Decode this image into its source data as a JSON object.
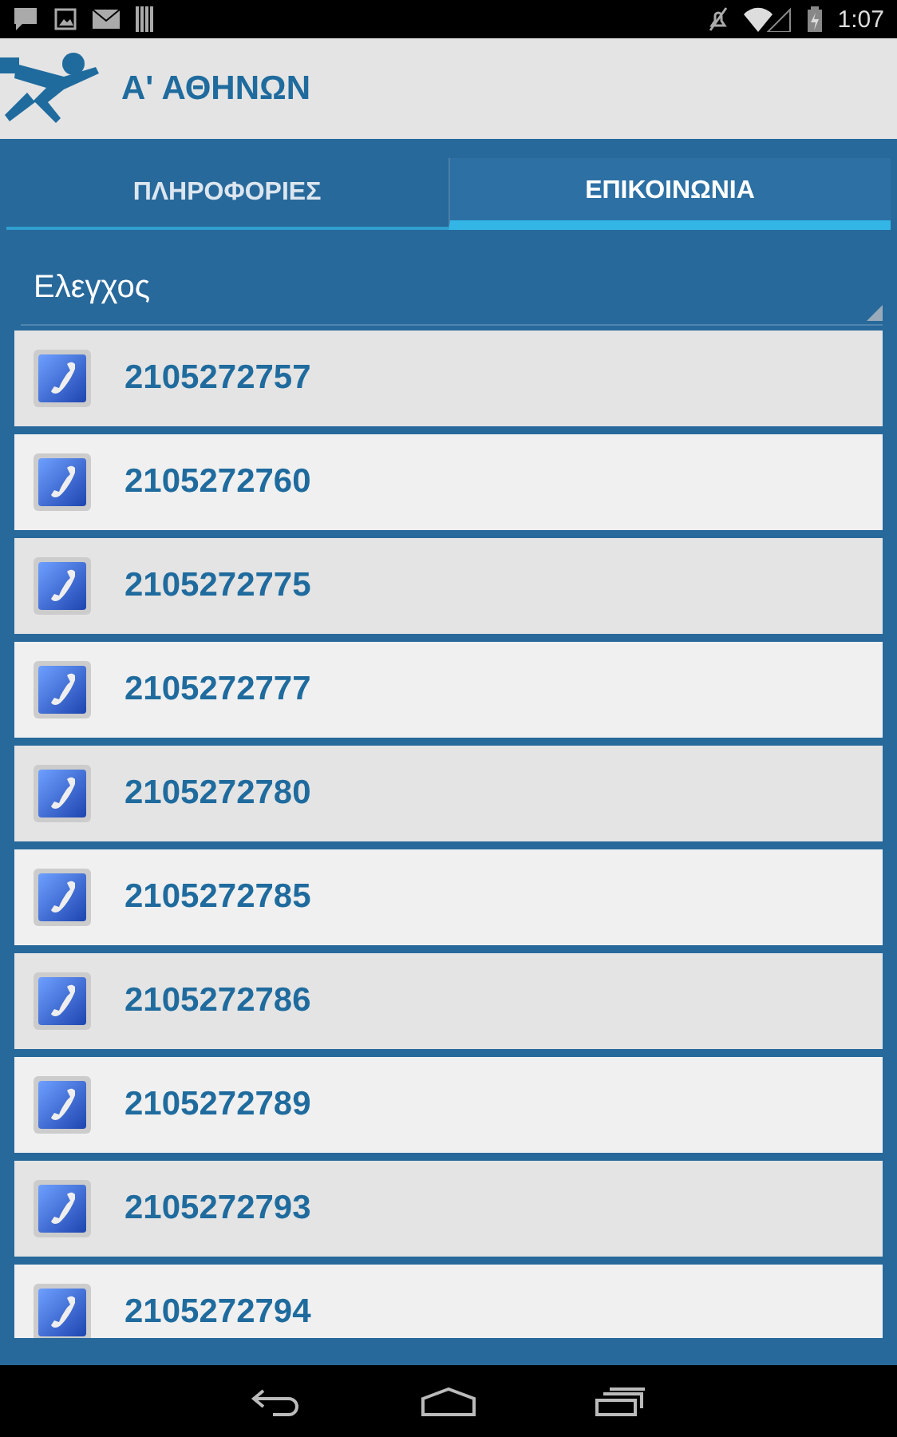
{
  "status_bar": {
    "time": "1:07"
  },
  "app_bar": {
    "title": "Α' ΑΘΗΝΩΝ"
  },
  "tabs": [
    {
      "label": "ΠΛΗΡΟΦΟΡΙΕΣ",
      "selected": false
    },
    {
      "label": "ΕΠΙΚΟΙΝΩΝΙΑ",
      "selected": true
    }
  ],
  "dropdown": {
    "value": "Ελεγχος"
  },
  "phone_numbers": [
    "2105272757",
    "2105272760",
    "2105272775",
    "2105272777",
    "2105272780",
    "2105272785",
    "2105272786",
    "2105272789",
    "2105272793",
    "2105272794"
  ]
}
